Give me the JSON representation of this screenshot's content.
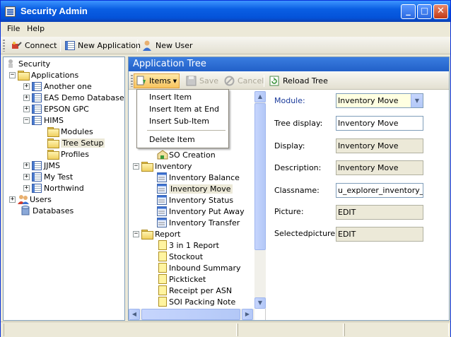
{
  "window": {
    "title": "Security Admin"
  },
  "menubar": {
    "file": "File",
    "help": "Help"
  },
  "toolbar": {
    "connect": "Connect",
    "new_application": "New Application",
    "new_user": "New User"
  },
  "left_tree": {
    "root": "Security",
    "applications": "Applications",
    "apps": [
      "Another one",
      "EAS Demo Database",
      "EPSON GPC",
      "HIMS"
    ],
    "hims_children": [
      "Modules",
      "Tree Setup",
      "Profiles"
    ],
    "more_apps": [
      "JJMS",
      "My Test",
      "Northwind"
    ],
    "users": "Users",
    "databases": "Databases"
  },
  "pane": {
    "title": "Application Tree"
  },
  "pane_toolbar": {
    "items": "Items",
    "save": "Save",
    "cancel": "Cancel",
    "reload": "Reload Tree"
  },
  "items_menu": {
    "insert_item": "Insert Item",
    "insert_item_at_end": "Insert Item at End",
    "insert_sub_item": "Insert Sub-Item",
    "delete_item": "Delete Item"
  },
  "app_tree": {
    "so_creation": "SO Creation",
    "inventory": "Inventory",
    "inventory_items": [
      "Inventory Balance",
      "Inventory Move",
      "Inventory Status",
      "Inventory Put Away",
      "Inventory Transfer"
    ],
    "report": "Report",
    "report_items": [
      "3 in 1 Report",
      "Stockout",
      "Inbound Summary",
      "Pickticket",
      "Receipt per ASN",
      "SOI Packing Note"
    ]
  },
  "form": {
    "module_label": "Module:",
    "module_value": "Inventory Move",
    "tree_display_label": "Tree display:",
    "tree_display_value": "Inventory Move",
    "display_label": "Display:",
    "display_value": "Inventory Move",
    "description_label": "Description:",
    "description_value": "Inventory Move",
    "classname_label": "Classname:",
    "classname_value": "u_explorer_inventory_mc",
    "picture_label": "Picture:",
    "picture_value": "EDIT",
    "selectedpicture_label": "Selectedpicture:",
    "selectedpicture_value": "EDIT"
  },
  "colors": {
    "titlebar": "#0a5fe3",
    "pane_header": "#2f6fd8",
    "selection": "#ece9d8",
    "module_field": "#ffffe1"
  }
}
